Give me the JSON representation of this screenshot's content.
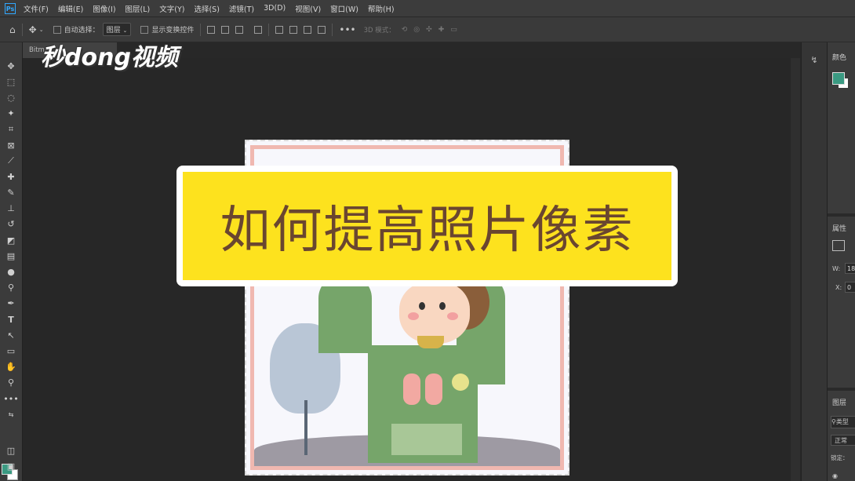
{
  "menubar": {
    "logo": "Ps",
    "items": [
      "文件(F)",
      "编辑(E)",
      "图像(I)",
      "图层(L)",
      "文字(Y)",
      "选择(S)",
      "滤镜(T)",
      "3D(D)",
      "视图(V)",
      "窗口(W)",
      "帮助(H)"
    ]
  },
  "options": {
    "auto_select_label": "自动选择：",
    "layer_select_value": "图层",
    "show_transform_label": "显示变换控件",
    "mode_3d_label": "3D 模式："
  },
  "document": {
    "tab_label": "Bitm"
  },
  "overlay": {
    "logo_text": "秒dong视频",
    "banner_text": "如何提高照片像素"
  },
  "panels": {
    "color_title": "颜色",
    "properties_title": "属性",
    "w_label": "W:",
    "w_value": "18",
    "x_label": "X:",
    "x_value": "0",
    "layers_title": "图层",
    "type_label": "类型",
    "blend_mode": "正常",
    "lock_label": "锁定："
  },
  "colors": {
    "foreground": "#3a9a82",
    "background": "#ffffff",
    "banner_fill": "#fde21e",
    "banner_text": "#6a4630"
  }
}
